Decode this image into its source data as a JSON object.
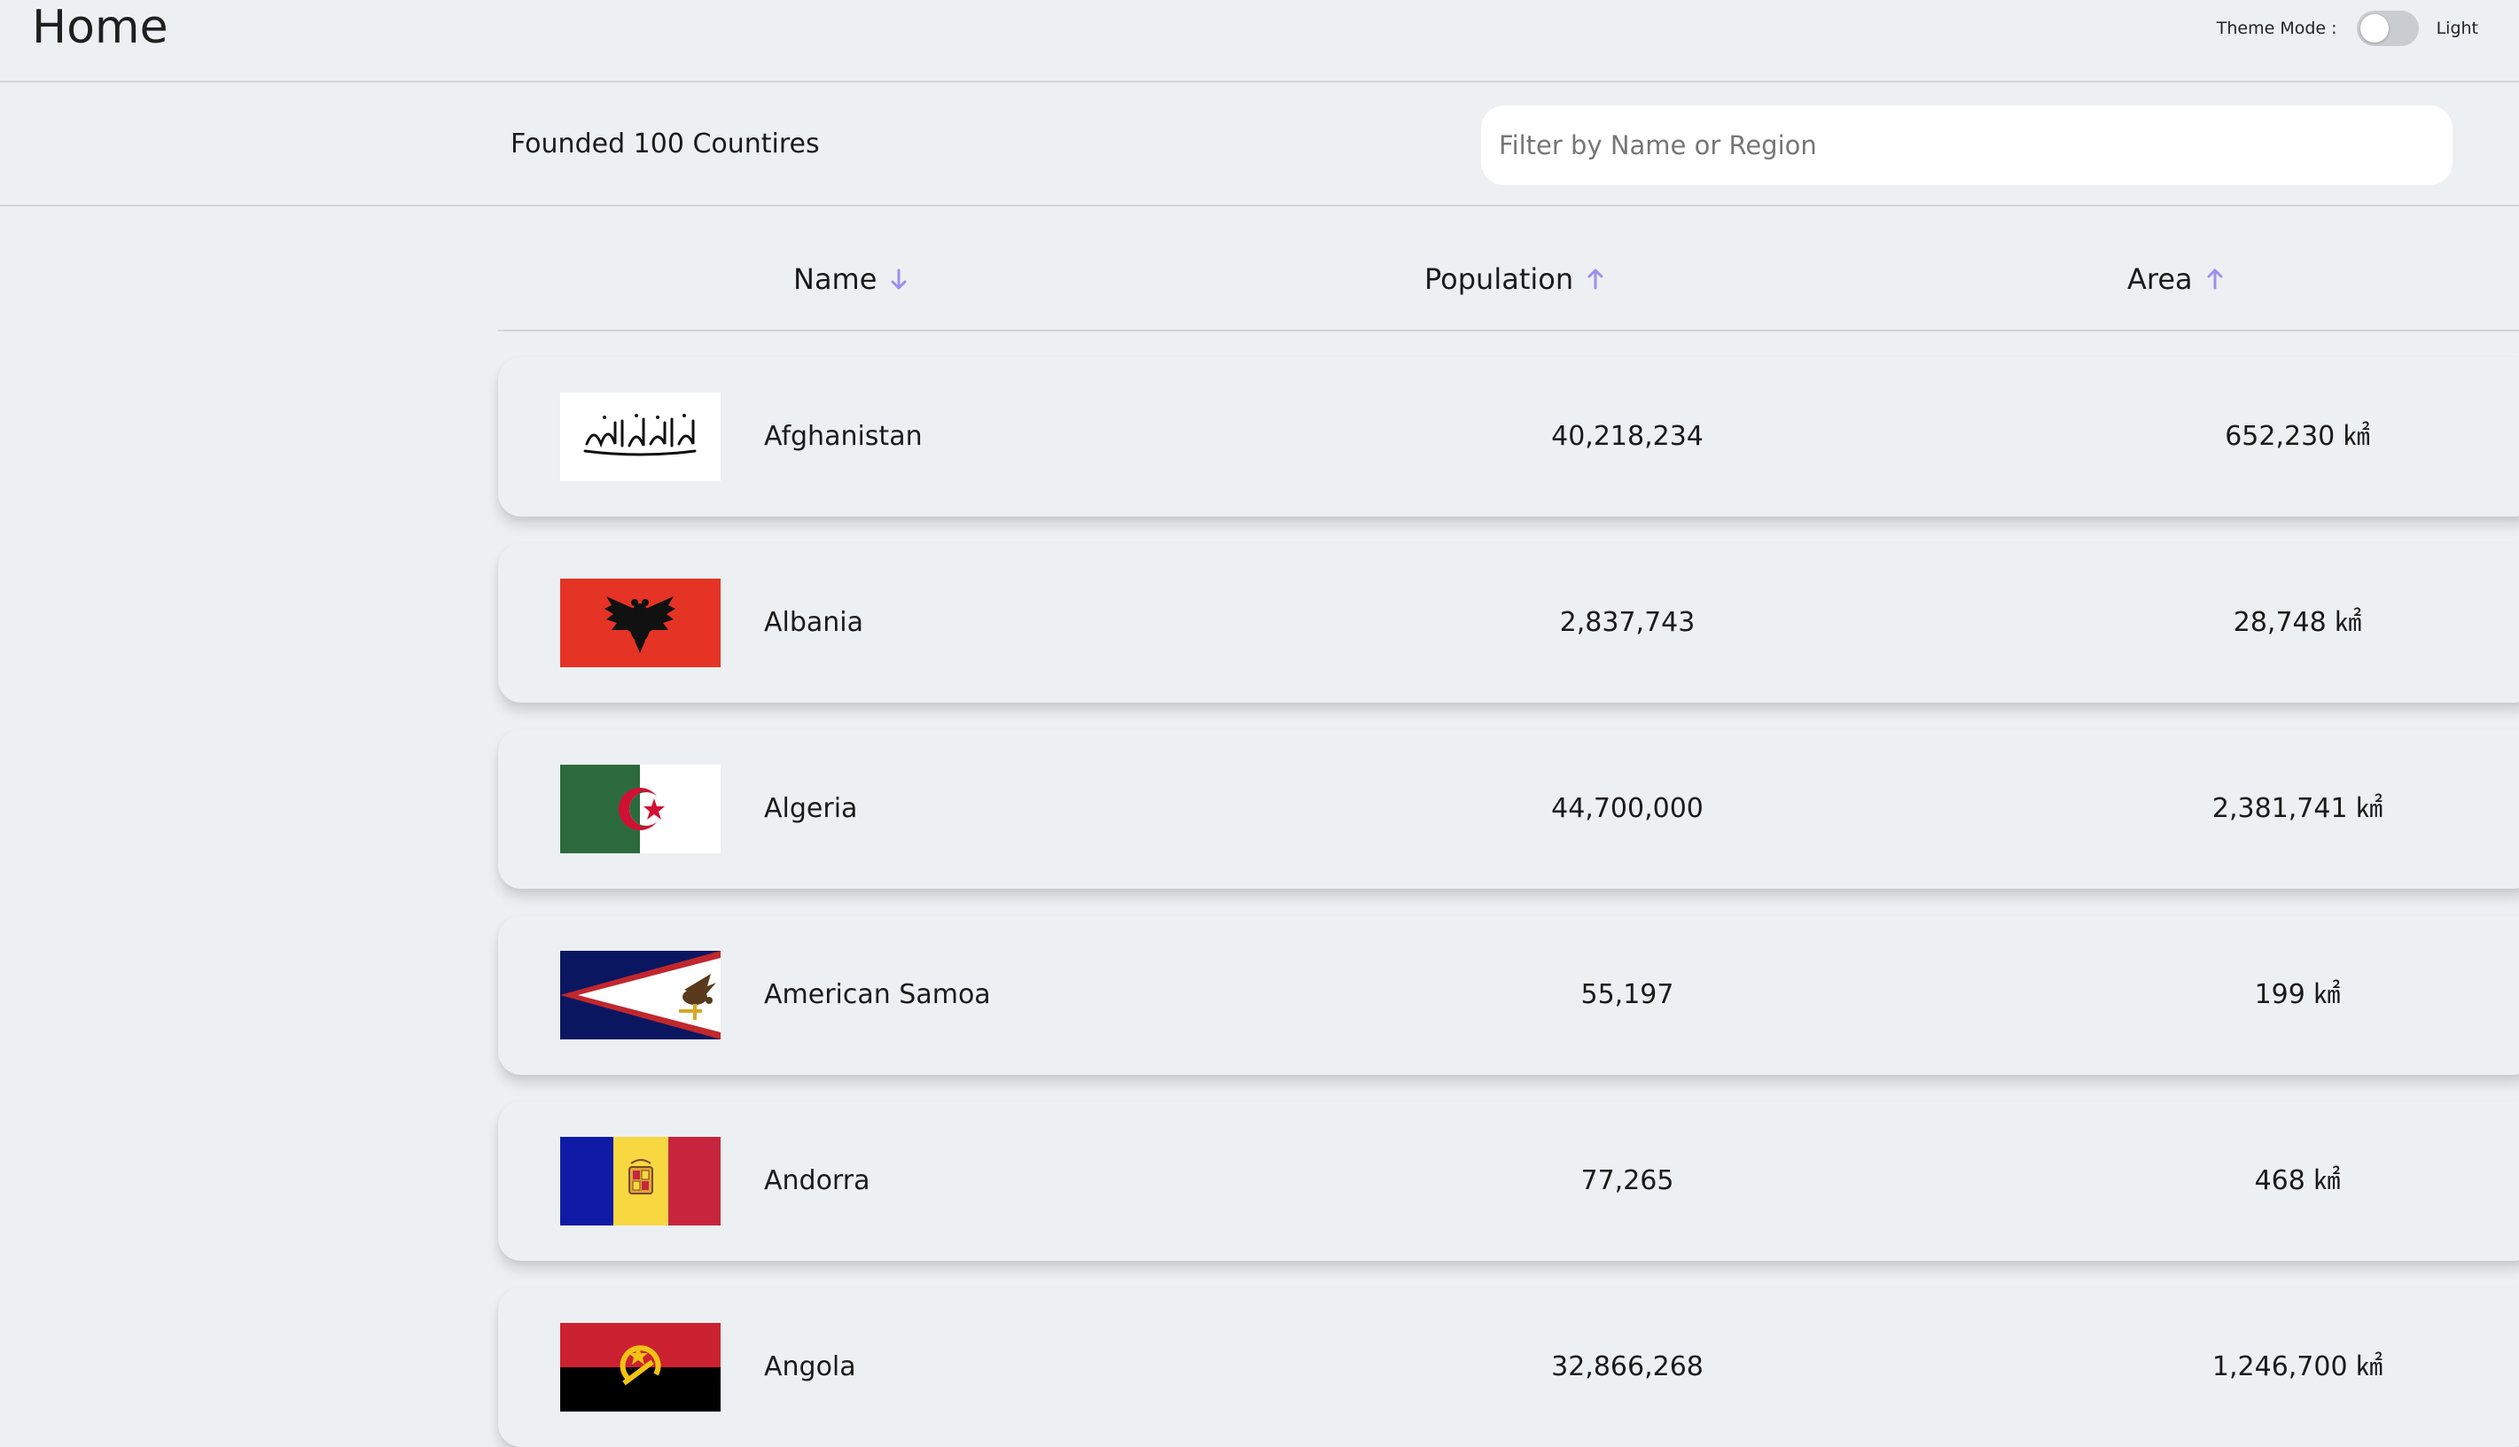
{
  "header": {
    "title": "Home",
    "theme_label": "Theme Mode :",
    "theme_value": "Light"
  },
  "toolbar": {
    "count_text": "Founded 100 Countires",
    "filter_placeholder": "Filter by Name or Region"
  },
  "table": {
    "columns": [
      {
        "label": "Name",
        "sort": "descending",
        "arrow_icon": "arrow-down-icon"
      },
      {
        "label": "Population",
        "sort": "ascending",
        "arrow_icon": "arrow-up-icon"
      },
      {
        "label": "Area",
        "sort": "ascending",
        "arrow_icon": "arrow-up-icon"
      }
    ],
    "rows": [
      {
        "name": "Afghanistan",
        "population": "40,218,234",
        "area": "652,230 ㎢"
      },
      {
        "name": "Albania",
        "population": "2,837,743",
        "area": "28,748 ㎢"
      },
      {
        "name": "Algeria",
        "population": "44,700,000",
        "area": "2,381,741 ㎢"
      },
      {
        "name": "American Samoa",
        "population": "55,197",
        "area": "199 ㎢"
      },
      {
        "name": "Andorra",
        "population": "77,265",
        "area": "468 ㎢"
      },
      {
        "name": "Angola",
        "population": "32,866,268",
        "area": "1,246,700 ㎢"
      }
    ]
  },
  "colors": {
    "background": "#edf0f2",
    "sort_arrow": "#9b8ff0",
    "toggle_track": "#c9cdd1",
    "toggle_knob": "#ffffff"
  }
}
